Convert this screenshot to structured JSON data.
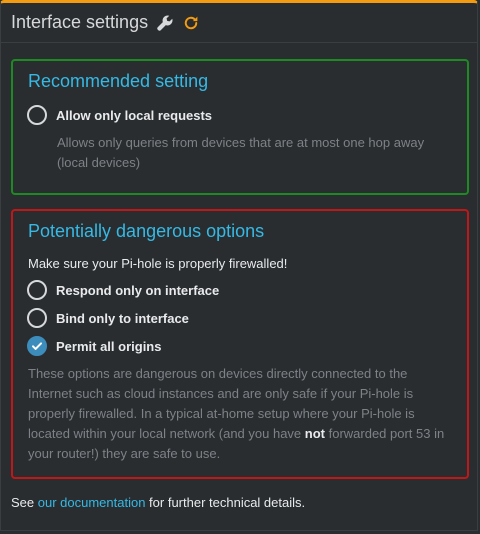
{
  "header": {
    "title": "Interface settings",
    "accent_color": "#f39c12",
    "wrench_icon": "wrench-icon",
    "refresh_icon": "refresh-icon"
  },
  "recommended": {
    "title": "Recommended setting",
    "border_color": "#1f8a24",
    "option_label": "Allow only local requests",
    "option_checked": false,
    "help_line1": "Allows only queries from devices that are at most one hop away",
    "help_line2": "(local devices)"
  },
  "dangerous": {
    "title": "Potentially dangerous options",
    "border_color": "#c0171a",
    "warning": "Make sure your Pi-hole is properly firewalled!",
    "options": [
      {
        "label": "Respond only on interface",
        "checked": false
      },
      {
        "label": "Bind only to interface",
        "checked": false
      },
      {
        "label": "Permit all origins",
        "checked": true
      }
    ],
    "help_line1": "These options are dangerous on devices directly connected to the",
    "help_line2": "Internet such as cloud instances and are only safe if your Pi-hole is",
    "help_line3": "properly firewalled. In a typical at-home setup where your Pi-hole is",
    "help_line4_pre": "located within your local network (and you have ",
    "help_line4_bold": "not",
    "help_line4_post": " forwarded port 53 in",
    "help_line5": "your router!) they are safe to use."
  },
  "footer": {
    "prefix": "See ",
    "link": "our documentation",
    "suffix": " for further technical details."
  }
}
